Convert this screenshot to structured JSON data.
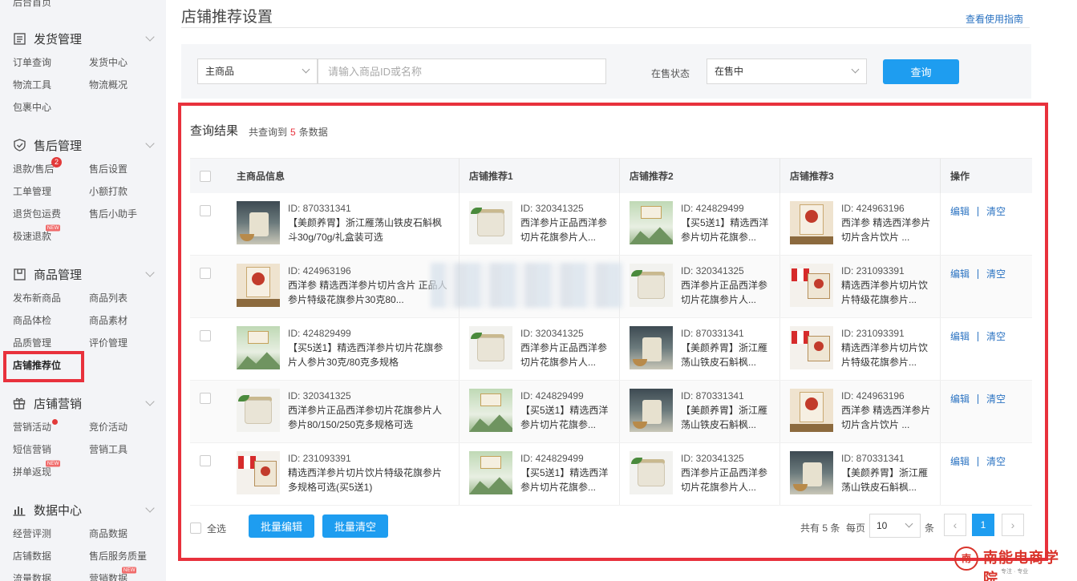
{
  "sidebar": {
    "top_item": "后台首页",
    "sections": [
      {
        "title": "发货管理",
        "icon": "list-icon",
        "items": [
          {
            "label": "订单查询"
          },
          {
            "label": "发货中心"
          },
          {
            "label": "物流工具"
          },
          {
            "label": "物流概况"
          },
          {
            "label": "包裹中心"
          }
        ]
      },
      {
        "title": "售后管理",
        "icon": "shield-icon",
        "items": [
          {
            "label": "退款/售后",
            "badge": "2"
          },
          {
            "label": "售后设置"
          },
          {
            "label": "工单管理"
          },
          {
            "label": "小额打款"
          },
          {
            "label": "退货包运费"
          },
          {
            "label": "售后小助手"
          },
          {
            "label": "极速退款",
            "tag": "NEW"
          }
        ]
      },
      {
        "title": "商品管理",
        "icon": "box-icon",
        "items": [
          {
            "label": "发布新商品"
          },
          {
            "label": "商品列表"
          },
          {
            "label": "商品体检"
          },
          {
            "label": "商品素材"
          },
          {
            "label": "品质管理"
          },
          {
            "label": "评价管理"
          },
          {
            "label": "店铺推荐位",
            "active": true
          }
        ]
      },
      {
        "title": "店铺营销",
        "icon": "gift-icon",
        "items": [
          {
            "label": "营销活动",
            "dot": true
          },
          {
            "label": "竞价活动"
          },
          {
            "label": "短信营销"
          },
          {
            "label": "营销工具"
          },
          {
            "label": "拼单返现",
            "tag": "NEW"
          }
        ]
      },
      {
        "title": "数据中心",
        "icon": "bar-chart-icon",
        "items": [
          {
            "label": "经营评测"
          },
          {
            "label": "商品数据"
          },
          {
            "label": "店铺数据"
          },
          {
            "label": "售后服务质量"
          },
          {
            "label": "流量数据"
          },
          {
            "label": "营销数据",
            "tag": "NEW"
          }
        ]
      }
    ]
  },
  "page": {
    "title": "店铺推荐设置",
    "guide_link": "查看使用指南"
  },
  "filter": {
    "type_select": "主商品",
    "search_placeholder": "请输入商品ID或名称",
    "status_label": "在售状态",
    "status_select": "在售中",
    "query_button": "查询"
  },
  "results": {
    "title": "查询结果",
    "count_prefix": "共查询到",
    "count": "5",
    "count_suffix": "条数据",
    "columns": [
      "主商品信息",
      "店铺推荐1",
      "店铺推荐2",
      "店铺推荐3",
      "操作"
    ],
    "rows": [
      {
        "main": {
          "id": "ID: 870331341",
          "name": "【美颜养胃】浙江雁荡山铁皮石斛枫斗30g/70g/礼盒装可选",
          "thumb": "dark"
        },
        "recs": [
          {
            "id": "ID: 320341325",
            "name": "西洋参片正品西洋参切片花旗参片人...",
            "thumb": "jar"
          },
          {
            "id": "ID: 424829499",
            "name": "【买5送1】精选西洋参片切片花旗参...",
            "thumb": "green"
          },
          {
            "id": "ID: 424963196",
            "name": "西洋参 精选西洋参片切片含片饮片 ...",
            "thumb": "beige"
          }
        ]
      },
      {
        "main": {
          "id": "ID: 424963196",
          "name": "西洋参 精选西洋参片切片含片 正品人参片特级花旗参片30克80...",
          "thumb": "beige"
        },
        "recs": [
          {
            "id": "",
            "name": "",
            "thumb": "none"
          },
          {
            "id": "ID: 320341325",
            "name": "西洋参片正品西洋参切片花旗参片人...",
            "thumb": "jar"
          },
          {
            "id": "ID: 231093391",
            "name": "精选西洋参片切片饮片特级花旗参片...",
            "thumb": "flag"
          }
        ]
      },
      {
        "main": {
          "id": "ID: 424829499",
          "name": "【买5送1】精选西洋参片切片花旗参片人参片30克/80克多规格",
          "thumb": "green"
        },
        "recs": [
          {
            "id": "ID: 320341325",
            "name": "西洋参片正品西洋参切片花旗参片人...",
            "thumb": "jar"
          },
          {
            "id": "ID: 870331341",
            "name": "【美颜养胃】浙江雁荡山铁皮石斛枫...",
            "thumb": "dark"
          },
          {
            "id": "ID: 231093391",
            "name": "精选西洋参片切片饮片特级花旗参片...",
            "thumb": "flag"
          }
        ]
      },
      {
        "main": {
          "id": "ID: 320341325",
          "name": "西洋参片正品西洋参切片花旗参片人参片80/150/250克多规格可选",
          "thumb": "jar"
        },
        "recs": [
          {
            "id": "ID: 424829499",
            "name": "【买5送1】精选西洋参片切片花旗参...",
            "thumb": "green"
          },
          {
            "id": "ID: 870331341",
            "name": "【美颜养胃】浙江雁荡山铁皮石斛枫...",
            "thumb": "dark"
          },
          {
            "id": "ID: 424963196",
            "name": "西洋参 精选西洋参片切片含片饮片 ...",
            "thumb": "beige"
          }
        ]
      },
      {
        "main": {
          "id": "ID: 231093391",
          "name": "精选西洋参片切片饮片特级花旗参片多规格可选(买5送1)",
          "thumb": "flag"
        },
        "recs": [
          {
            "id": "ID: 424829499",
            "name": "【买5送1】精选西洋参片切片花旗参...",
            "thumb": "green"
          },
          {
            "id": "ID: 320341325",
            "name": "西洋参片正品西洋参切片花旗参片人...",
            "thumb": "jar"
          },
          {
            "id": "ID: 870331341",
            "name": "【美颜养胃】浙江雁荡山铁皮石斛枫...",
            "thumb": "dark"
          }
        ]
      }
    ],
    "op_edit": "编辑",
    "op_clear": "清空",
    "select_all": "全选",
    "batch_edit": "批量编辑",
    "batch_clear": "批量清空"
  },
  "pagination": {
    "total": "共有 5 条",
    "per_page_label": "每页",
    "per_page": "10",
    "unit": "条",
    "prev": "‹",
    "page": "1",
    "next": "›"
  },
  "watermark": {
    "icon_text": "南",
    "text": "南能电商学院",
    "sub": "专注 · 专业"
  },
  "colors": {
    "primary": "#1e9df0",
    "link": "#2b73c2",
    "highlight": "#e8313c"
  }
}
